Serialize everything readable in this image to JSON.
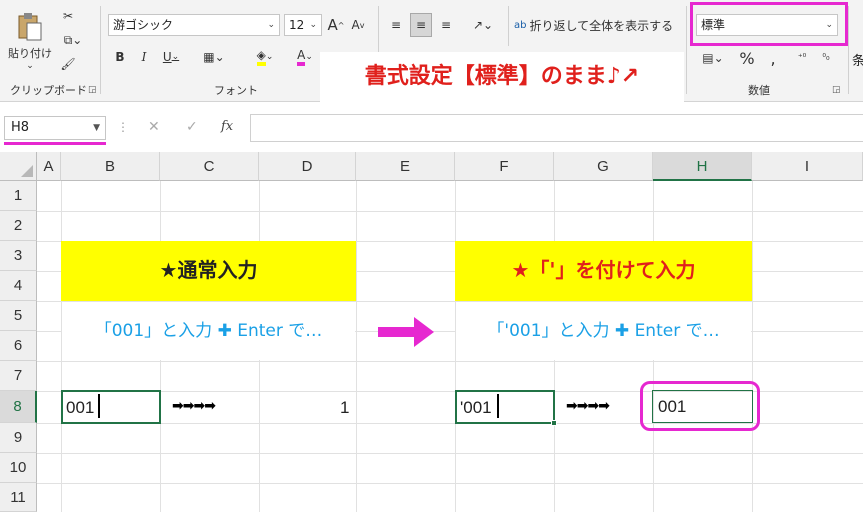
{
  "ribbon": {
    "clipboard": {
      "paste_label": "貼り付け",
      "group_label": "クリップボード"
    },
    "font": {
      "font_name": "游ゴシック",
      "font_size": "12",
      "grow_label": "A",
      "shrink_label": "A",
      "bold": "B",
      "italic": "I",
      "underline": "U",
      "font_color_label": "A",
      "group_label": "フォント",
      "highlight_color": "#ffff00",
      "font_color": "#e628d0"
    },
    "alignment": {
      "wrap_text_label": "折り返して全体を表示する",
      "wrap_icon": "ab"
    },
    "number": {
      "format_value": "標準",
      "percent": "%",
      "group_label": "数値"
    },
    "styles_partial": "条"
  },
  "callout": "書式設定【標準】のまま♪↗",
  "formula_bar": {
    "name_box": "H8",
    "cancel": "✕",
    "enter": "✓",
    "fx": "fx",
    "formula": ""
  },
  "columns": [
    "A",
    "B",
    "C",
    "D",
    "E",
    "F",
    "G",
    "H",
    "I"
  ],
  "rows": [
    "1",
    "2",
    "3",
    "4",
    "5",
    "6",
    "7",
    "8",
    "9",
    "10",
    "11"
  ],
  "sheet": {
    "left_banner": "★通常入力",
    "right_banner": "★「'」を付けて入力",
    "left_note": "「001」と入力 ✚ Enter で…",
    "right_note": "「'001」と入力 ✚ Enter で…",
    "b8": "001",
    "d8": "1",
    "f8": "'001",
    "h8": "001",
    "arrows": "➡➡➡➡"
  },
  "colors": {
    "accent_magenta": "#e628d0",
    "excel_green": "#217346",
    "banner_yellow": "#ffff00",
    "note_blue": "#1aa0e6",
    "callout_red": "#e0201c"
  }
}
